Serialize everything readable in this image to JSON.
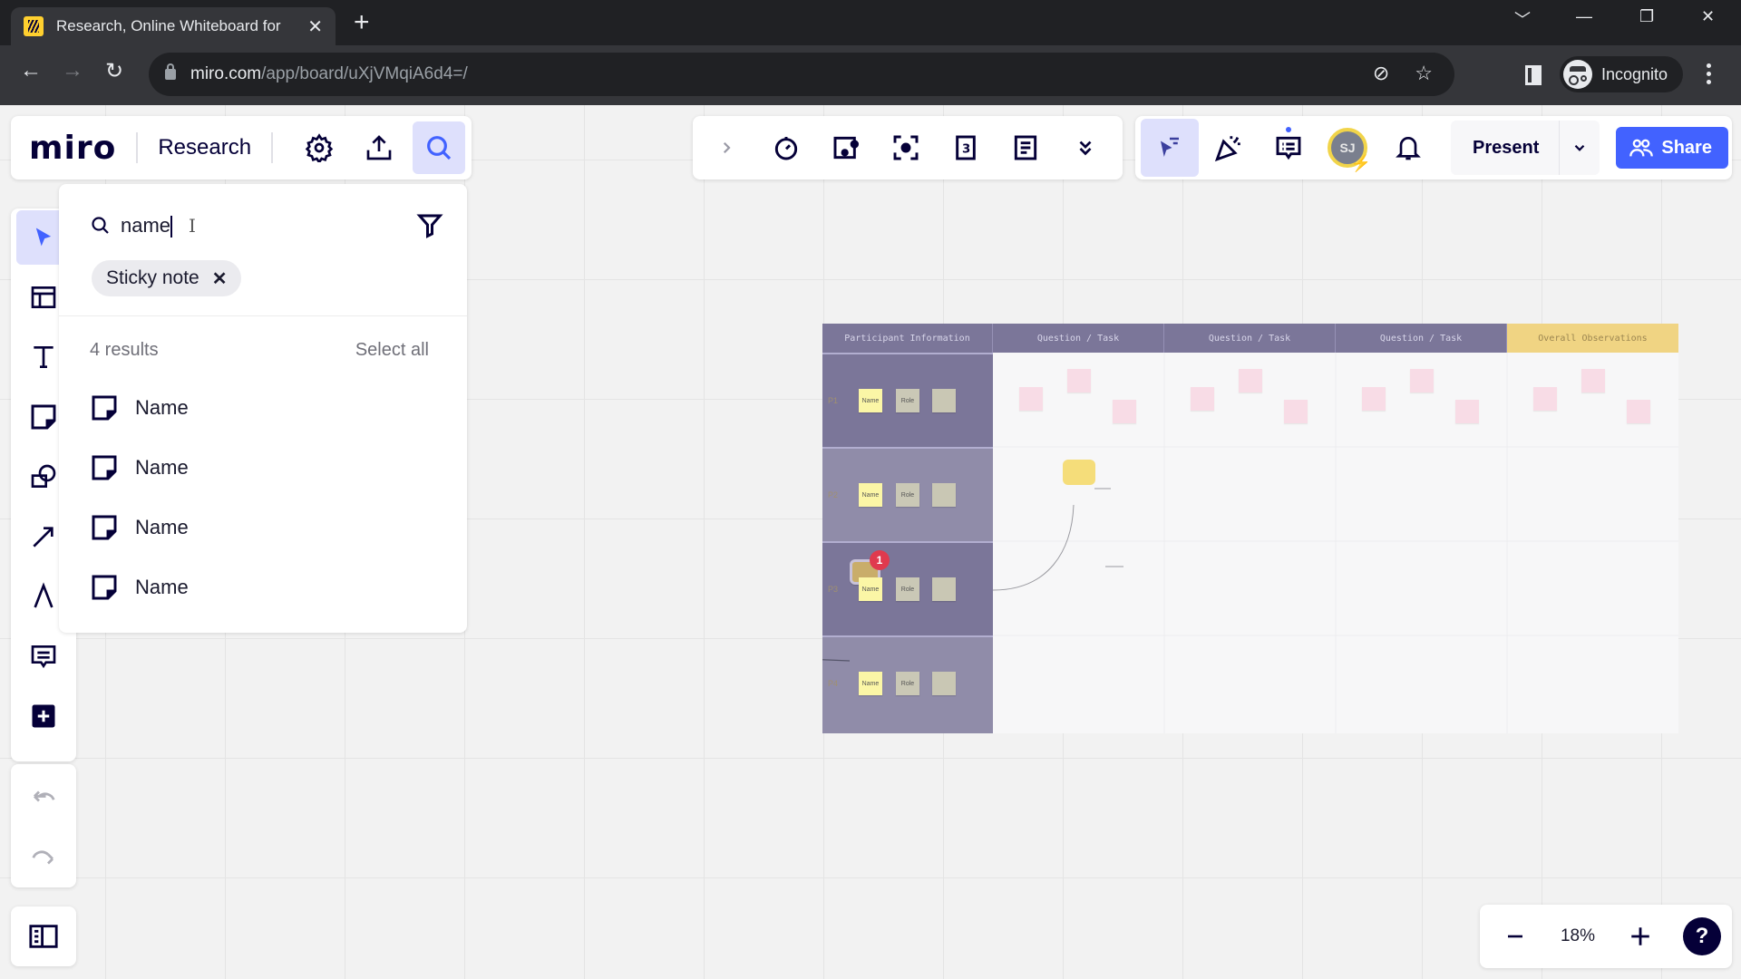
{
  "browser": {
    "tab_title": "Research, Online Whiteboard for",
    "url_host": "miro.com",
    "url_path": "/app/board/uXjVMqiA6d4=/",
    "profile_label": "Incognito"
  },
  "board_bar": {
    "logo": "miro",
    "board_name": "Research",
    "icons": [
      "gear-icon",
      "upload-icon",
      "search-icon"
    ]
  },
  "search": {
    "query": "name",
    "filter_chip": "Sticky note",
    "results_count": "4 results",
    "select_all": "Select all",
    "results": [
      {
        "label": "Name",
        "icon": "sticky-note-icon"
      },
      {
        "label": "Name",
        "icon": "sticky-note-icon"
      },
      {
        "label": "Name",
        "icon": "sticky-note-icon"
      },
      {
        "label": "Name",
        "icon": "sticky-note-icon"
      }
    ]
  },
  "left_toolbar": {
    "tools": [
      "select",
      "templates",
      "text",
      "sticky-note",
      "shapes",
      "connection-line",
      "pen",
      "comment",
      "more-apps"
    ],
    "active_tool": "select"
  },
  "collab_toolbar": {
    "icons": [
      "expand-chevron",
      "timer",
      "voting",
      "attention",
      "estimation",
      "notes",
      "more"
    ]
  },
  "right_toolbar": {
    "avatar_initials": "SJ",
    "present_label": "Present",
    "share_label": "Share",
    "accent_color": "#4262ff"
  },
  "zoom": {
    "level": "18%"
  },
  "board": {
    "headers": [
      "Participant Information",
      "Question / Task",
      "Question / Task",
      "Question / Task",
      "Overall Observations"
    ],
    "header_color": "#7b7699",
    "observations_color": "#f0d483",
    "rows": [
      {
        "label": "P1",
        "name": "Name",
        "role": "Role"
      },
      {
        "label": "P2",
        "name": "Name",
        "role": "Role"
      },
      {
        "label": "P3",
        "name": "Name",
        "role": "Role",
        "comment_count": "1"
      },
      {
        "label": "P4",
        "name": "Name",
        "role": "Role"
      }
    ]
  }
}
